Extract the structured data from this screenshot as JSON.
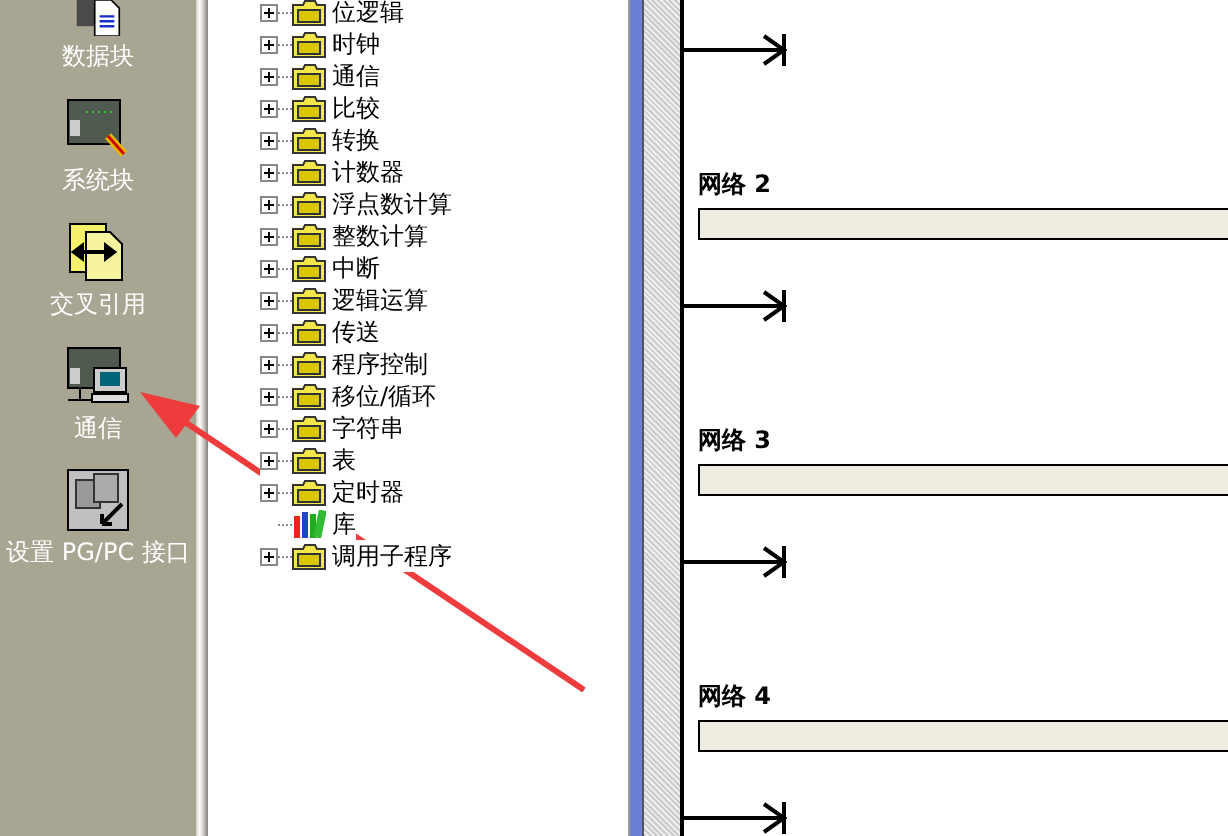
{
  "sidebar": {
    "items": [
      {
        "label": "数据块",
        "kind": "data"
      },
      {
        "label": "系统块",
        "kind": "system"
      },
      {
        "label": "交叉引用",
        "kind": "xref"
      },
      {
        "label": "通信",
        "kind": "comm"
      },
      {
        "label": "设置 PG/PC 接口",
        "kind": "pgpc"
      }
    ]
  },
  "tree": {
    "items": [
      {
        "label": "位逻辑",
        "expandable": true,
        "kind": "folder"
      },
      {
        "label": "时钟",
        "expandable": true,
        "kind": "folder"
      },
      {
        "label": "通信",
        "expandable": true,
        "kind": "folder"
      },
      {
        "label": "比较",
        "expandable": true,
        "kind": "folder"
      },
      {
        "label": "转换",
        "expandable": true,
        "kind": "folder"
      },
      {
        "label": "计数器",
        "expandable": true,
        "kind": "folder"
      },
      {
        "label": "浮点数计算",
        "expandable": true,
        "kind": "folder"
      },
      {
        "label": "整数计算",
        "expandable": true,
        "kind": "folder"
      },
      {
        "label": "中断",
        "expandable": true,
        "kind": "folder"
      },
      {
        "label": "逻辑运算",
        "expandable": true,
        "kind": "folder"
      },
      {
        "label": "传送",
        "expandable": true,
        "kind": "folder"
      },
      {
        "label": "程序控制",
        "expandable": true,
        "kind": "folder"
      },
      {
        "label": "移位/循环",
        "expandable": true,
        "kind": "folder"
      },
      {
        "label": "字符串",
        "expandable": true,
        "kind": "folder"
      },
      {
        "label": "表",
        "expandable": true,
        "kind": "folder"
      },
      {
        "label": "定时器",
        "expandable": true,
        "kind": "folder"
      },
      {
        "label": "库",
        "expandable": false,
        "kind": "library"
      },
      {
        "label": "调用子程序",
        "expandable": true,
        "kind": "folder"
      }
    ]
  },
  "ladder": {
    "networks": [
      {
        "title": "网络 2"
      },
      {
        "title": "网络 3"
      },
      {
        "title": "网络 4"
      }
    ]
  },
  "annotation": {
    "kind": "arrow"
  }
}
